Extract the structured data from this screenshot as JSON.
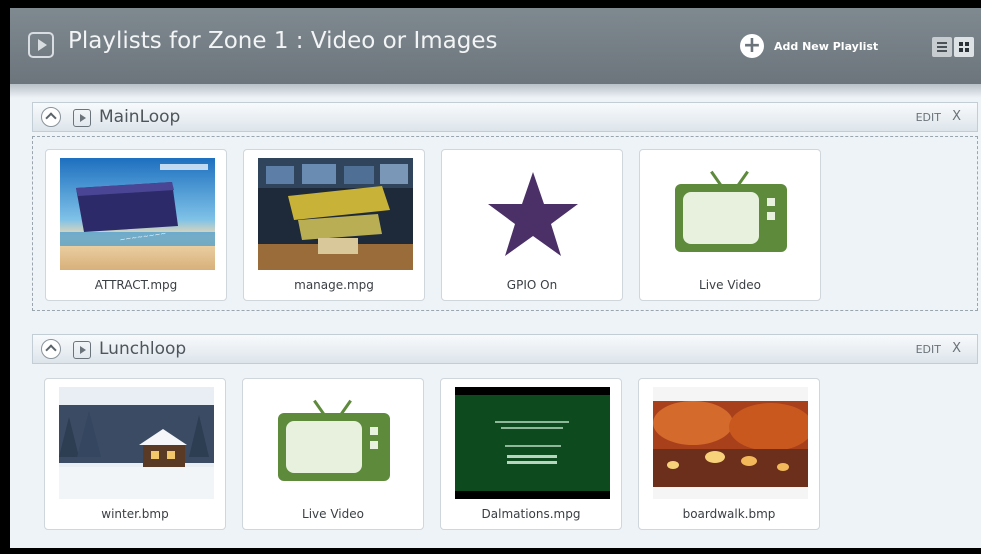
{
  "header": {
    "title": "Playlists for Zone 1 : Video or Images",
    "add_label": "Add New Playlist"
  },
  "playlists": [
    {
      "name": "MainLoop",
      "edit_label": "EDIT",
      "close_label": "X",
      "items": [
        {
          "label": "ATTRACT.mpg",
          "thumb": "video-thumbnail"
        },
        {
          "label": "manage.mpg",
          "thumb": "video-thumbnail"
        },
        {
          "label": "GPIO On",
          "thumb": "star-icon"
        },
        {
          "label": "Live Video",
          "thumb": "tv-icon"
        }
      ]
    },
    {
      "name": "Lunchloop",
      "edit_label": "EDIT",
      "close_label": "X",
      "items": [
        {
          "label": "winter.bmp",
          "thumb": "image-thumbnail"
        },
        {
          "label": "Live Video",
          "thumb": "tv-icon"
        },
        {
          "label": "Dalmations.mpg",
          "thumb": "video-thumbnail"
        },
        {
          "label": "boardwalk.bmp",
          "thumb": "image-thumbnail"
        }
      ]
    }
  ],
  "colors": {
    "header_bg": "#737d84",
    "tv_green": "#5e8a3c",
    "star_purple": "#4b2f67"
  }
}
